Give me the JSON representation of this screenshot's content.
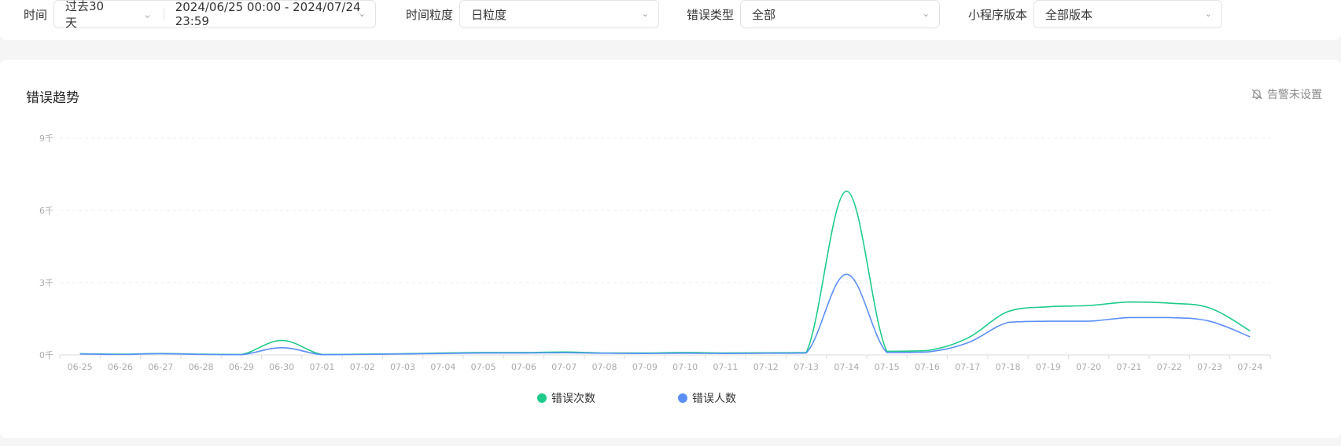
{
  "filters": {
    "time": {
      "label": "时间",
      "range_value": "过去30天",
      "date_value": "2024/06/25 00:00 - 2024/07/24 23:59"
    },
    "granularity": {
      "label": "时间粒度",
      "value": "日粒度"
    },
    "error_type": {
      "label": "错误类型",
      "value": "全部"
    },
    "version": {
      "label": "小程序版本",
      "value": "全部版本"
    }
  },
  "card": {
    "title": "错误趋势",
    "alarm_label": "告警未设置",
    "alarm_icon": "bell-off-icon"
  },
  "colors": {
    "series_errors": "#1ecb8a",
    "series_users": "#5b8ff9",
    "grid": "#ececec",
    "axis_text": "#aaaaaa"
  },
  "chart_data": {
    "type": "line",
    "title": "错误趋势",
    "xlabel": "",
    "ylabel": "",
    "ylim": [
      0,
      9000
    ],
    "yticks": [
      0,
      3000,
      6000,
      9000
    ],
    "ytick_labels": [
      "0千",
      "3千",
      "6千",
      "9千"
    ],
    "grid": true,
    "smooth": true,
    "legend_position": "bottom",
    "categories": [
      "06-25",
      "06-26",
      "06-27",
      "06-28",
      "06-29",
      "06-30",
      "07-01",
      "07-02",
      "07-03",
      "07-04",
      "07-05",
      "07-06",
      "07-07",
      "07-08",
      "07-09",
      "07-10",
      "07-11",
      "07-12",
      "07-13",
      "07-14",
      "07-15",
      "07-16",
      "07-17",
      "07-18",
      "07-19",
      "07-20",
      "07-21",
      "07-22",
      "07-23",
      "07-24"
    ],
    "series": [
      {
        "name": "错误次数",
        "values": [
          50,
          30,
          60,
          30,
          20,
          600,
          20,
          30,
          50,
          80,
          100,
          100,
          120,
          80,
          80,
          100,
          80,
          90,
          100,
          6800,
          150,
          180,
          700,
          1800,
          2000,
          2050,
          2200,
          2150,
          1950,
          1000
        ]
      },
      {
        "name": "错误人数",
        "values": [
          40,
          20,
          50,
          20,
          10,
          300,
          10,
          20,
          40,
          60,
          80,
          80,
          90,
          70,
          60,
          70,
          60,
          70,
          80,
          3350,
          100,
          120,
          500,
          1350,
          1400,
          1400,
          1550,
          1550,
          1400,
          750
        ]
      }
    ]
  }
}
